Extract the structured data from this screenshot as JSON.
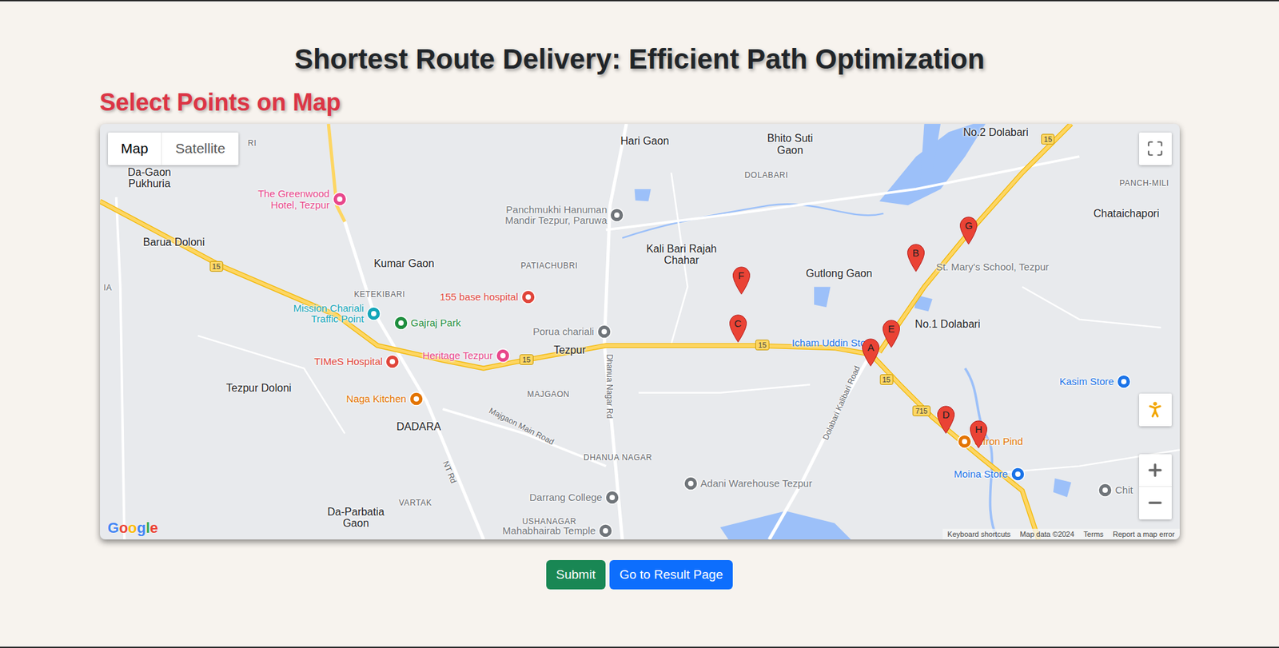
{
  "page": {
    "title": "Shortest Route Delivery: Efficient Path Optimization",
    "subtitle": "Select Points on Map"
  },
  "map": {
    "type_toggle": [
      {
        "label": "Map",
        "selected": true
      },
      {
        "label": "Satellite",
        "selected": false
      }
    ],
    "places": [
      {
        "label": "RI",
        "kind": "locality"
      },
      {
        "label": "Hari Gaon",
        "kind": "town"
      },
      {
        "label": "Bhito Suti Gaon",
        "kind": "town"
      },
      {
        "label": "DOLABARI",
        "kind": "locality"
      },
      {
        "label": "No.2 Dolabari",
        "kind": "town"
      },
      {
        "label": "PANCH-MILI",
        "kind": "locality"
      },
      {
        "label": "Chataichapori",
        "kind": "town"
      },
      {
        "label": "Da-Gaon Pukhuria",
        "kind": "town"
      },
      {
        "label": "Kali Bari Rajah Chahar",
        "kind": "town"
      },
      {
        "label": "Barua Doloni",
        "kind": "town"
      },
      {
        "label": "Kumar Gaon",
        "kind": "town"
      },
      {
        "label": "PATIACHUBRI",
        "kind": "locality"
      },
      {
        "label": "Gutlong Gaon",
        "kind": "town"
      },
      {
        "label": "KETEKIBARI",
        "kind": "locality"
      },
      {
        "label": "IA",
        "kind": "locality"
      },
      {
        "label": "No.1 Dolabari",
        "kind": "town"
      },
      {
        "label": "Tezpur",
        "kind": "town"
      },
      {
        "label": "Tezpur Doloni",
        "kind": "town"
      },
      {
        "label": "MAJGAON",
        "kind": "locality"
      },
      {
        "label": "DADARA",
        "kind": "town"
      },
      {
        "label": "DHANUA NAGAR",
        "kind": "locality"
      },
      {
        "label": "VARTAK",
        "kind": "locality"
      },
      {
        "label": "Da-Parbatia Gaon",
        "kind": "town"
      },
      {
        "label": "USHANAGAR",
        "kind": "locality"
      },
      {
        "label": "St. Mary's School, Tezpur",
        "kind": "poi",
        "color": "#70757a"
      },
      {
        "label": "Icham Uddin Store",
        "kind": "poi",
        "color": "#1a73e8"
      }
    ],
    "roads": [
      "Dhanua Nagar Rd",
      "Dolabari Kalibari Road",
      "Majgaon Main Road",
      "NT Rd"
    ],
    "route_shields": [
      "15",
      "15",
      "15",
      "15",
      "15",
      "715"
    ],
    "pois": [
      {
        "label": "The Greenwood Hotel, Tezpur",
        "color": "#e8478b"
      },
      {
        "label": "Panchmukhi Hanuman Mandir Tezpur, Paruwa",
        "color": "#70757a"
      },
      {
        "label": "155 base hospital",
        "color": "#e0453a"
      },
      {
        "label": "Mission Chariali Traffic Point",
        "color": "#12a5b8"
      },
      {
        "label": "Gajraj Park",
        "color": "#1e8e3e"
      },
      {
        "label": "Porua chariali",
        "color": "#70757a"
      },
      {
        "label": "TIMeS Hospital",
        "color": "#e0453a"
      },
      {
        "label": "Heritage Tezpur",
        "color": "#e8478b"
      },
      {
        "label": "Naga Kitchen",
        "color": "#e37400"
      },
      {
        "label": "Kasim Store",
        "color": "#1a73e8"
      },
      {
        "label": "affron Pind",
        "color": "#e37400"
      },
      {
        "label": "Moina Store",
        "color": "#1a73e8"
      },
      {
        "label": "Adani Warehouse Tezpur",
        "color": "#70757a"
      },
      {
        "label": "Chit",
        "color": "#70757a"
      },
      {
        "label": "Darrang College",
        "color": "#70757a"
      },
      {
        "label": "Mahabhairab Temple",
        "color": "#70757a"
      }
    ],
    "markers": [
      "A",
      "B",
      "C",
      "D",
      "E",
      "F",
      "G",
      "H"
    ],
    "logo": "Google",
    "footer": [
      "Keyboard shortcuts",
      "Map data ©2024",
      "Terms",
      "Report a map error"
    ]
  },
  "buttons": [
    {
      "label": "Submit",
      "color": "#198754"
    },
    {
      "label": "Go to Result Page",
      "color": "#0d6efd"
    }
  ]
}
